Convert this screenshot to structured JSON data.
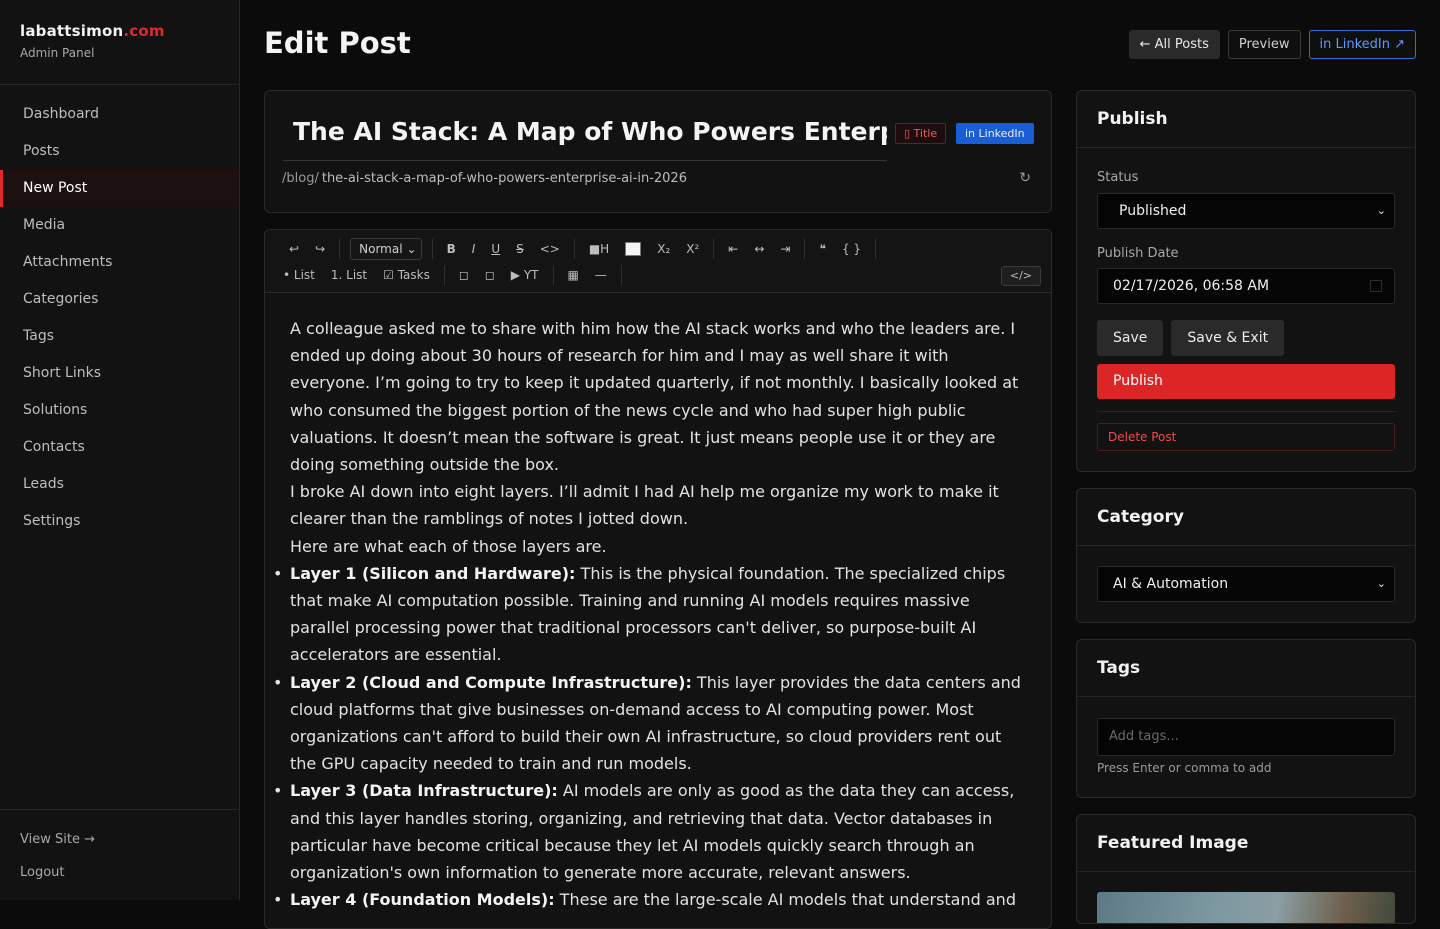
{
  "brand": {
    "name": "labattsimon",
    "tld": ".com",
    "subtitle": "Admin Panel"
  },
  "nav": [
    "Dashboard",
    "Posts",
    "New Post",
    "Media",
    "Attachments",
    "Categories",
    "Tags",
    "Short Links",
    "Solutions",
    "Contacts",
    "Leads",
    "Settings"
  ],
  "nav_active": "New Post",
  "sidebar_footer": {
    "view_site": "View Site →",
    "logout": "Logout"
  },
  "header": {
    "title": "Edit Post",
    "all_posts": "← All Posts",
    "preview": "Preview",
    "linkedin": "in LinkedIn ↗"
  },
  "post": {
    "title": "The AI Stack: A Map of Who Powers Enterp",
    "title_badge": "▯ Title",
    "linkedin_badge": "in LinkedIn",
    "slug_prefix": "/blog/",
    "slug": "the-ai-stack-a-map-of-who-powers-enterprise-ai-in-2026",
    "refresh_icon": "↻"
  },
  "toolbar": {
    "undo": "↩",
    "redo": "↪",
    "format": "Normal",
    "bold": "B",
    "italic": "I",
    "underline": "U",
    "strike": "S",
    "code": "<>",
    "highlight": "■H",
    "sub": "X₂",
    "sup": "X²",
    "align_left": "⇤",
    "align_center": "↔",
    "align_right": "⇥",
    "quote": "❝",
    "codeblock": "{ }",
    "bullet_list": "• List",
    "ordered_list": "1. List",
    "tasks": "☑ Tasks",
    "img1": "◻",
    "img2": "◻",
    "youtube": "▶ YT",
    "table": "▦",
    "hr": "—",
    "html_toggle": "</>"
  },
  "content": {
    "p1": "A colleague asked me to share with him how the AI stack works and who the leaders are. I ended up doing about 30 hours of research for him and I may as well share it with everyone. I’m going to try to keep it updated quarterly, if not monthly. I basically looked at who consumed the biggest portion of the news cycle and who had super high public valuations. It doesn’t mean the software is great. It just means people use it or they are doing something outside the box.",
    "p2": "I broke AI down into eight layers. I’ll admit I had AI help me organize my work to make it clearer than the ramblings of notes I jotted down.",
    "p3": "Here are what each of those layers are.",
    "layers": [
      {
        "title": "Layer 1 (Silicon and Hardware):",
        "text": " This is the physical foundation. The specialized chips that make AI computation possible. Training and running AI models requires massive parallel processing power that traditional processors can't deliver, so purpose-built AI accelerators are essential."
      },
      {
        "title": "Layer 2 (Cloud and Compute Infrastructure):",
        "text": " This layer provides the data centers and cloud platforms that give businesses on-demand access to AI computing power. Most organizations can't afford to build their own AI infrastructure, so cloud providers rent out the GPU capacity needed to train and run models."
      },
      {
        "title": "Layer 3 (Data Infrastructure):",
        "text": " AI models are only as good as the data they can access, and this layer handles storing, organizing, and retrieving that data. Vector databases in particular have become critical because they let AI models quickly search through an organization's own information to generate more accurate, relevant answers."
      },
      {
        "title": "Layer 4 (Foundation Models):",
        "text": " These are the large-scale AI models that understand and"
      }
    ]
  },
  "publish": {
    "heading": "Publish",
    "status_label": "Status",
    "status_value": "Published",
    "date_label": "Publish Date",
    "date_value": "02/17/2026, 06:58 AM",
    "save": "Save",
    "save_exit": "Save & Exit",
    "publish": "Publish",
    "delete": "Delete Post"
  },
  "category": {
    "heading": "Category",
    "value": "AI & Automation"
  },
  "tags": {
    "heading": "Tags",
    "placeholder": "Add tags...",
    "hint": "Press Enter or comma to add"
  },
  "featured": {
    "heading": "Featured Image"
  },
  "colors": {
    "accent": "#dc2626",
    "brand_tld": "#e0282e",
    "linkedin": "#1a5ed6"
  }
}
